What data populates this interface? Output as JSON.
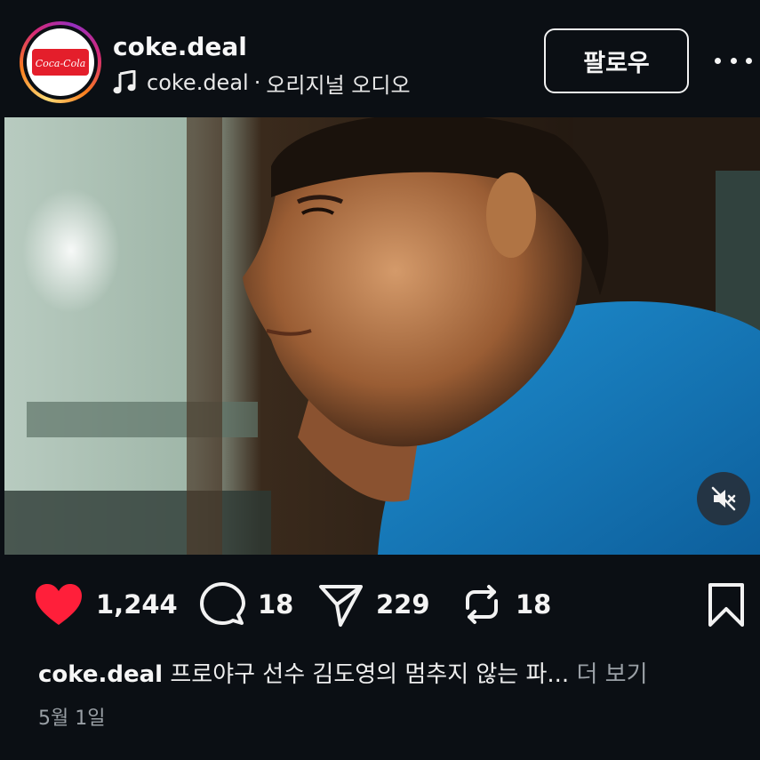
{
  "post": {
    "username": "coke.deal",
    "audio_owner": "coke.deal",
    "audio_separator": "·",
    "audio_label": "오리지널 오디오",
    "follow_label": "팔로우",
    "avatar_logo_text": "Coca-Cola",
    "brand_color": "#e41e2b"
  },
  "actions": {
    "likes": "1,244",
    "comments": "18",
    "shares": "229",
    "reposts": "18",
    "like_color": "#ff1f3a"
  },
  "caption": {
    "username": "coke.deal",
    "text": "프로야구 선수 김도영의 멈추지 않는 파...",
    "more_label": "더 보기"
  },
  "date": "5월 1일",
  "icons": {
    "music": "music-note-icon",
    "more": "more-horizontal-icon",
    "mute": "volume-muted-icon",
    "like": "heart-filled-icon",
    "comment": "comment-icon",
    "share": "send-icon",
    "repost": "repost-icon",
    "save": "bookmark-icon"
  }
}
